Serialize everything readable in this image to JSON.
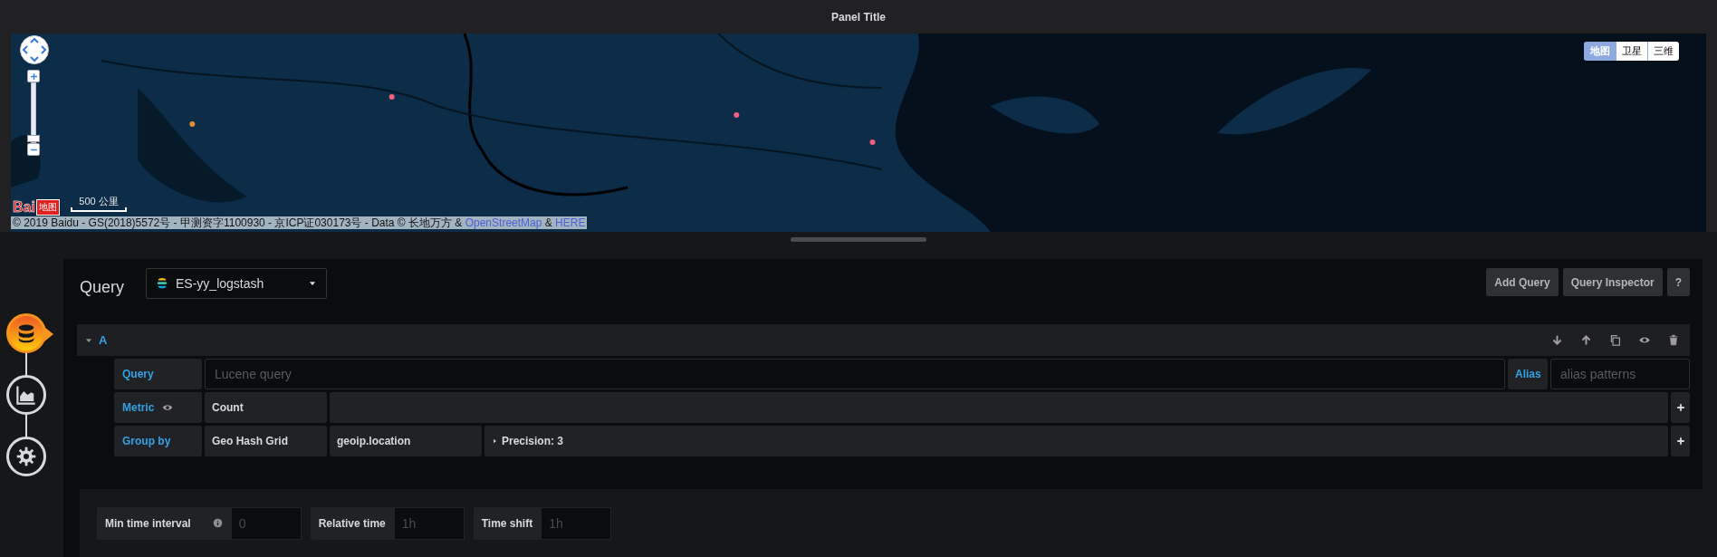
{
  "panel": {
    "title": "Panel Title"
  },
  "map": {
    "kind": "picture",
    "zoom": {
      "level": 0.06
    },
    "logo": {
      "text": "Bai",
      "suffix": "地图"
    },
    "scale": "500 公里",
    "map_types": [
      {
        "label": "地图",
        "selected": true
      },
      {
        "label": "卫星",
        "selected": false
      },
      {
        "label": "三维",
        "selected": false
      }
    ],
    "copyright": [
      {
        "kind": "text",
        "text": "© 2019 Baidu - GS(2018)5572号 - 甲测资字1100930 - 京ICP证030173号 - Data © 长地万方 & "
      },
      {
        "kind": "link",
        "text": "OpenStreetMap"
      },
      {
        "kind": "text",
        "text": " & "
      },
      {
        "kind": "link",
        "text": "HERE"
      }
    ]
  },
  "steps": [
    {
      "kind": "queries",
      "selected": true
    },
    {
      "kind": "visualization",
      "selected": false
    },
    {
      "kind": "general",
      "selected": false
    }
  ],
  "query": {
    "title": "Query",
    "datasource": "ES-yy_logstash",
    "buttons": [
      "Add Query",
      "Query Inspector",
      "?"
    ],
    "rows": [
      {
        "ref": "A",
        "expanded": true,
        "query": {
          "label": "Query",
          "placeholder": "Lucene query"
        },
        "alias": {
          "label": "Alias",
          "placeholder": "alias patterns"
        },
        "metric": {
          "label": "Metric",
          "visible": true,
          "type": "Count"
        },
        "group_by": {
          "label": "Group by",
          "aggregation": "Geo Hash Grid",
          "field": "geoip.location",
          "settings": "Precision: 3"
        }
      }
    ]
  },
  "options": [
    {
      "label": "Min time interval",
      "info": true,
      "placeholder": "0"
    },
    {
      "label": "Relative time",
      "info": false,
      "placeholder": "1h"
    },
    {
      "label": "Time shift",
      "info": false,
      "placeholder": "1h"
    }
  ]
}
